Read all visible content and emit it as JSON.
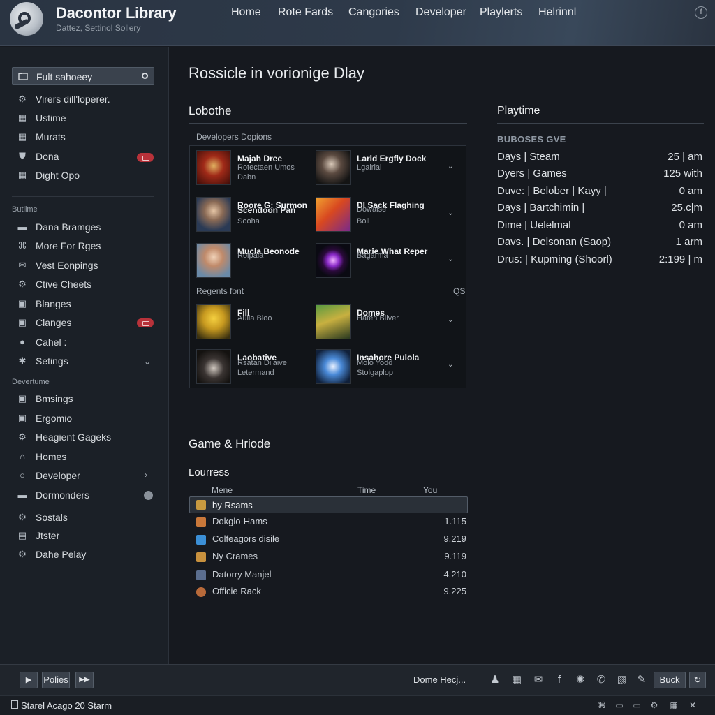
{
  "header": {
    "title": "Dacontor Library",
    "subtitle": "Dattez, Settinol Sollery",
    "nav": [
      "Home",
      "Rote Fards",
      "Cangories",
      "Developer",
      "Playlerts",
      "Helrinnl"
    ]
  },
  "sidebar": {
    "search_value": "Fult sahoeey",
    "items_top": [
      {
        "label": "Virers dill'loperer.",
        "icon": "gear-icon"
      },
      {
        "label": "Ustime",
        "icon": "grid-icon"
      },
      {
        "label": "Murats",
        "icon": "grid-icon"
      },
      {
        "label": "Dona",
        "icon": "shield-icon"
      },
      {
        "label": "Dight Opo",
        "icon": "grid-icon"
      }
    ],
    "section1": "Butlime",
    "items_mid": [
      {
        "label": "Dana Bramges",
        "icon": "folder-icon"
      },
      {
        "label": "More For Rges",
        "icon": "network-icon"
      },
      {
        "label": "Vest Eonpings",
        "icon": "mail-icon"
      },
      {
        "label": "Ctive Cheets",
        "icon": "gear-icon"
      },
      {
        "label": "Blanges",
        "icon": "box-icon"
      },
      {
        "label": "Clanges",
        "icon": "box-icon"
      },
      {
        "label": "Cahel :",
        "icon": "circle-icon"
      },
      {
        "label": "Setings",
        "icon": "star-icon"
      }
    ],
    "section2": "Devertume",
    "items_bot": [
      {
        "label": "Bmsings",
        "icon": "box-icon"
      },
      {
        "label": "Ergomio",
        "icon": "box-icon"
      },
      {
        "label": "Heagient Gageks",
        "icon": "gear-icon"
      },
      {
        "label": "Homes",
        "icon": "home-icon"
      },
      {
        "label": "Developer",
        "icon": "circle-icon"
      },
      {
        "label": "Dormonders",
        "icon": "box-icon"
      },
      {
        "label": "Sostals",
        "icon": "gear-icon"
      },
      {
        "label": "Jtster",
        "icon": "clipboard-icon"
      },
      {
        "label": "Dahe Pelay",
        "icon": "gear-icon"
      }
    ]
  },
  "main": {
    "title": "Rossicle in vorionige Dlay",
    "library_title": "Lobothe",
    "developers_label": "Developers Dopions",
    "recents_label": "Regents font",
    "recents_extra": "QS",
    "games": [
      {
        "title": "Majah Dree",
        "lines": [
          "Rotectaen Umos",
          "Dabn"
        ],
        "art": "art-red"
      },
      {
        "title": "Larld Ergfly Dock",
        "lines": [
          "Lgalrial"
        ],
        "art": "art-dark"
      },
      {
        "title": "Roore G: Surmon",
        "lines": [
          "Scendoon Pan",
          "Sooha"
        ],
        "art": "art-man"
      },
      {
        "title": "Dl Sack Flaghing",
        "lines": [
          "Dowalse",
          "Boll"
        ],
        "art": "art-orange"
      },
      {
        "title": "Mucla Beonode",
        "lines": [
          "Rolpala"
        ],
        "art": "art-woman"
      },
      {
        "title": "Marie What Reper",
        "lines": [
          "Bagarma"
        ],
        "art": "art-purple"
      },
      {
        "title": "Fill",
        "lines": [
          "Aulia Bloo"
        ],
        "art": "art-yellow"
      },
      {
        "title": "Domes",
        "lines": [
          "Haten Bliver"
        ],
        "art": "art-green"
      },
      {
        "title": "Laobative",
        "lines": [
          "Rsatan Dilaive",
          "Letermand"
        ],
        "art": "art-hood"
      },
      {
        "title": "Insahore Pulola",
        "lines": [
          "Molo Yodd",
          "Stolgaplop"
        ],
        "art": "art-blue"
      }
    ],
    "game_hr_title": "Game & Hriode",
    "lourress_title": "Lourress",
    "table_headers": [
      "Mene",
      "Time",
      "You"
    ],
    "table_selected": "by Rsams",
    "table_rows": [
      {
        "name": "Dokglo-Hams",
        "value": "1.115",
        "color": "#c9783a"
      },
      {
        "name": "Colfeagors disile",
        "value": "9.219",
        "color": "#3b8fd6"
      },
      {
        "name": "Ny Crames",
        "value": "9.119",
        "color": "#c8913e"
      },
      {
        "name": "Datorry Manjel",
        "value": "4.210",
        "color": "#5b6e8f"
      },
      {
        "name": "Officie Rack",
        "value": "9.225",
        "color": "#b86a3a"
      }
    ]
  },
  "playtime": {
    "title": "Playtime",
    "header": "BUBOSES GVE",
    "rows": [
      {
        "label": "Days | Steam",
        "value": "25 | am"
      },
      {
        "label": "Dyers | Games",
        "value": "125 with"
      },
      {
        "label": "Duve: | Belober | Kayy |",
        "value": "0 am"
      },
      {
        "label": "Days | Bartchimin |",
        "value": "25.c|m"
      },
      {
        "label": "Dime | Uelelmal",
        "value": "0 am"
      },
      {
        "label": "Davs. | Delsonan (Saop)",
        "value": "1 arm"
      },
      {
        "label": "Drus: | Kupming (Shoorl)",
        "value": "2:199 | m"
      }
    ]
  },
  "bottom": {
    "btn_label": "Polies",
    "center_text": "Dome Hecj...",
    "right_btn": "Buck"
  },
  "status": {
    "text": "Starel Acago 20 Starm"
  }
}
